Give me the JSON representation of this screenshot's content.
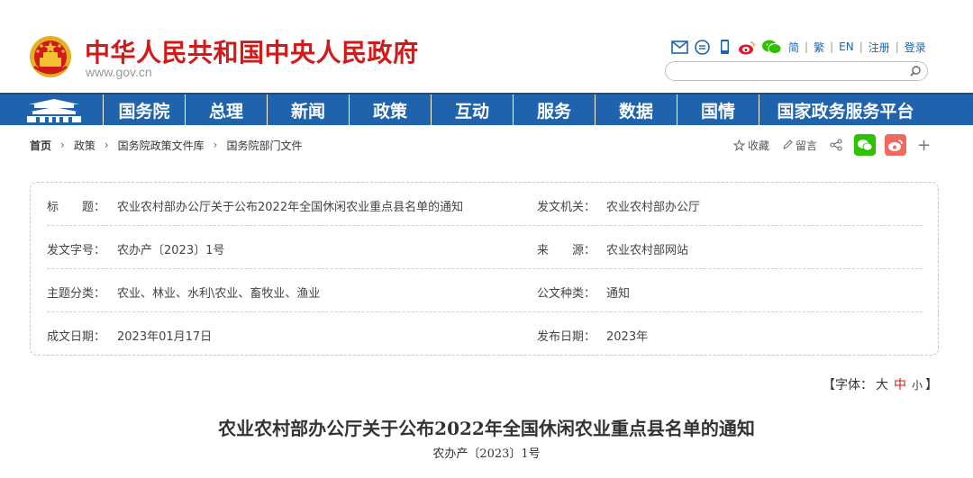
{
  "header": {
    "title": "中华人民共和国中央人民政府",
    "url": "www.gov.cn",
    "tools": [
      "mail-icon",
      "chat-icon",
      "mobile-icon",
      "weibo-icon",
      "wechat-icon"
    ],
    "lang": [
      "简",
      "繁",
      "EN",
      "注册",
      "登录"
    ],
    "search_placeholder": ""
  },
  "nav": {
    "items": [
      "国务院",
      "总理",
      "新闻",
      "政策",
      "互动",
      "服务",
      "数据",
      "国情",
      "国家政务服务平台"
    ]
  },
  "breadcrumb": [
    "首页",
    "政策",
    "国务院政策文件库",
    "国务院部门文件"
  ],
  "share": {
    "favorite": "收藏",
    "comment": "留言"
  },
  "info": {
    "rows": [
      {
        "label1": "标　　题：",
        "value1": "农业农村部办公厅关于公布2022年全国休闲农业重点县名单的通知",
        "label2": "发文机关：",
        "value2": "农业农村部办公厅"
      },
      {
        "label1": "发文字号：",
        "value1": "农办产〔2023〕1号",
        "label2": "来　　源：",
        "value2": "农业农村部网站"
      },
      {
        "label1": "主题分类：",
        "value1": "农业、林业、水利\\农业、畜牧业、渔业",
        "label2": "公文种类：",
        "value2": "通知"
      },
      {
        "label1": "成文日期：",
        "value1": "2023年01月17日",
        "label2": "发布日期：",
        "value2": "2023年"
      }
    ]
  },
  "fontsize": {
    "prefix": "【字体：",
    "large": "大",
    "medium": "中",
    "small": "小",
    "suffix": "】"
  },
  "document": {
    "title": "农业农村部办公厅关于公布2022年全国休闲农业重点县名单的通知",
    "number": "农办产〔2023〕1号"
  },
  "colors": {
    "brand_red": "#d11a1a",
    "nav_blue": "#1f63ad",
    "link_blue": "#1b63b4",
    "wechat_green": "#2dc100",
    "weibo_red": "#f06a5f"
  }
}
